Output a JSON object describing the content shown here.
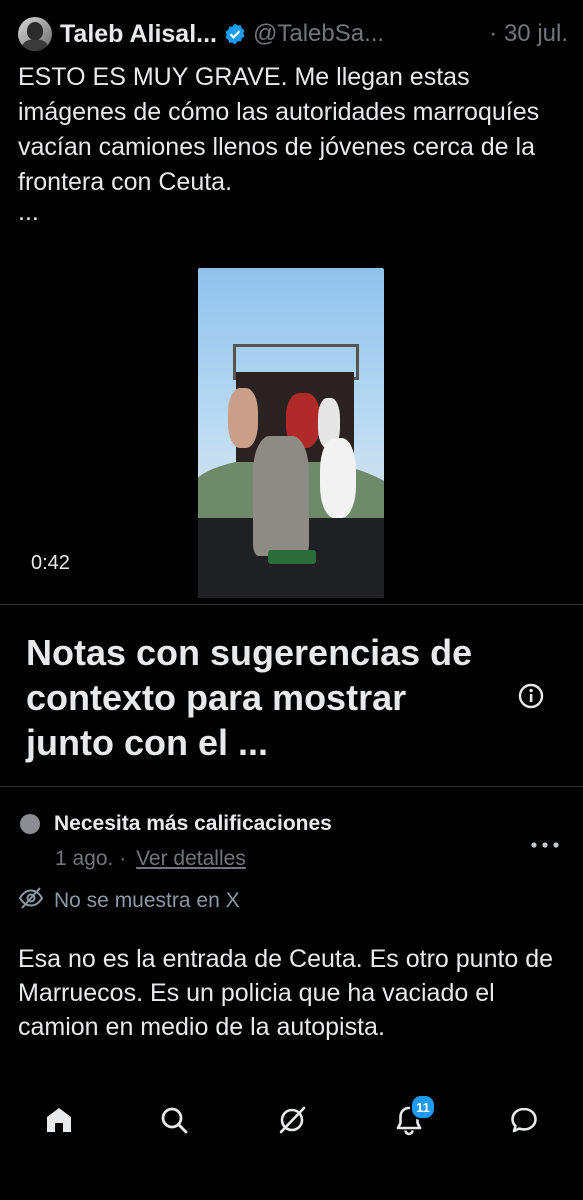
{
  "tweet": {
    "display_name": "Taleb Alisal...",
    "handle": "@TalebSa...",
    "date": "· 30 jul.",
    "text": "ESTO ES MUY GRAVE. Me llegan estas imágenes de cómo las autoridades marroquíes vacían camiones llenos de jóvenes cerca de la frontera con Ceuta.",
    "ellipsis": "...",
    "video_duration": "0:42"
  },
  "community_notes": {
    "title": "Notas con sugerencias de contexto para mostrar junto con el ...",
    "note": {
      "status": "Necesita más calificaciones",
      "date": "1 ago.",
      "separator": "·",
      "details_link": "Ver detalles",
      "visibility": "No se muestra en X",
      "body": "Esa no es la entrada de Ceuta. Es otro punto de Marruecos. Es un policia que ha vaciado el camion en medio de la autopista."
    }
  },
  "bottom_nav": {
    "items": [
      {
        "icon": "home-icon"
      },
      {
        "icon": "search-icon"
      },
      {
        "icon": "grok-icon"
      },
      {
        "icon": "bell-icon",
        "badge": "11"
      },
      {
        "icon": "chat-icon"
      }
    ]
  },
  "colors": {
    "background": "#000000",
    "text": "#e7e9ea",
    "secondary_text": "#71767b",
    "accent": "#1d9bf0"
  }
}
